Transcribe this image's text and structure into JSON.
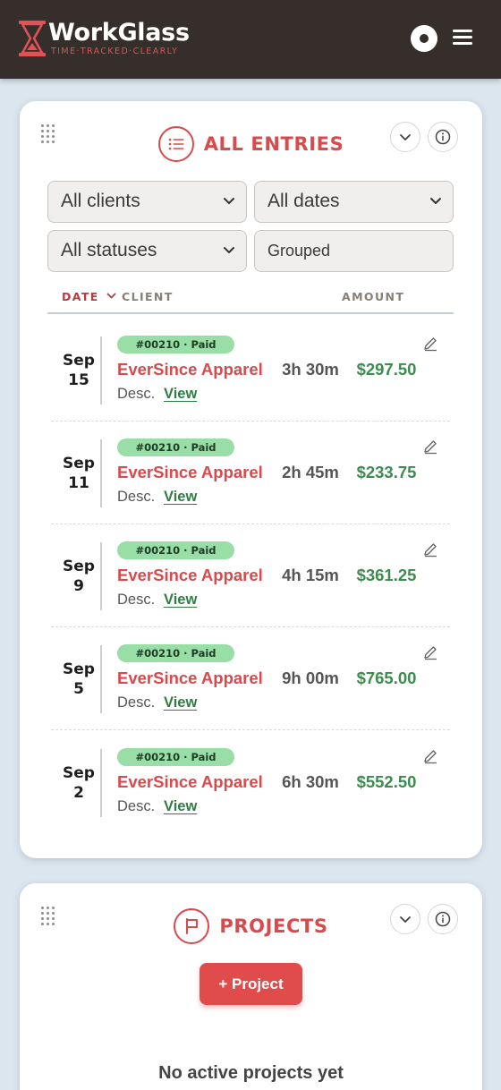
{
  "app": {
    "name": "WorkGlass",
    "tagline": "TIME·TRACKED·CLEARLY",
    "brand_color": "#e05254",
    "header_color": "#352e2a"
  },
  "header": {
    "icons": [
      "hourglass-logo-icon",
      "theme-toggle-icon",
      "hamburger-menu-icon"
    ]
  },
  "entries_panel": {
    "title": "ALL ENTRIES",
    "icon": "list-icon",
    "collapse_icon": "chevron-down-icon",
    "info_icon": "info-icon",
    "filters": {
      "client": "All clients",
      "dates": "All dates",
      "status": "All statuses",
      "grouping": "Grouped"
    },
    "columns": {
      "date": "DATE",
      "client": "CLIENT",
      "amount": "AMOUNT"
    },
    "rows": [
      {
        "month": "Sep",
        "day": "15",
        "badge": "#00210 · Paid",
        "client": "EverSince Apparel",
        "hours": "3h 30m",
        "amount": "$297.50",
        "desc": "Desc.",
        "view": "View"
      },
      {
        "month": "Sep",
        "day": "11",
        "badge": "#00210 · Paid",
        "client": "EverSince Apparel",
        "hours": "2h 45m",
        "amount": "$233.75",
        "desc": "Desc.",
        "view": "View"
      },
      {
        "month": "Sep",
        "day": "9",
        "badge": "#00210 · Paid",
        "client": "EverSince Apparel",
        "hours": "4h 15m",
        "amount": "$361.25",
        "desc": "Desc.",
        "view": "View"
      },
      {
        "month": "Sep",
        "day": "5",
        "badge": "#00210 · Paid",
        "client": "EverSince Apparel",
        "hours": "9h 00m",
        "amount": "$765.00",
        "desc": "Desc.",
        "view": "View"
      },
      {
        "month": "Sep",
        "day": "2",
        "badge": "#00210 · Paid",
        "client": "EverSince Apparel",
        "hours": "6h 30m",
        "amount": "$552.50",
        "desc": "Desc.",
        "view": "View"
      }
    ]
  },
  "projects_panel": {
    "title": "PROJECTS",
    "icon": "flag-icon",
    "add_button": "+ Project",
    "empty_message": "No active projects yet"
  }
}
